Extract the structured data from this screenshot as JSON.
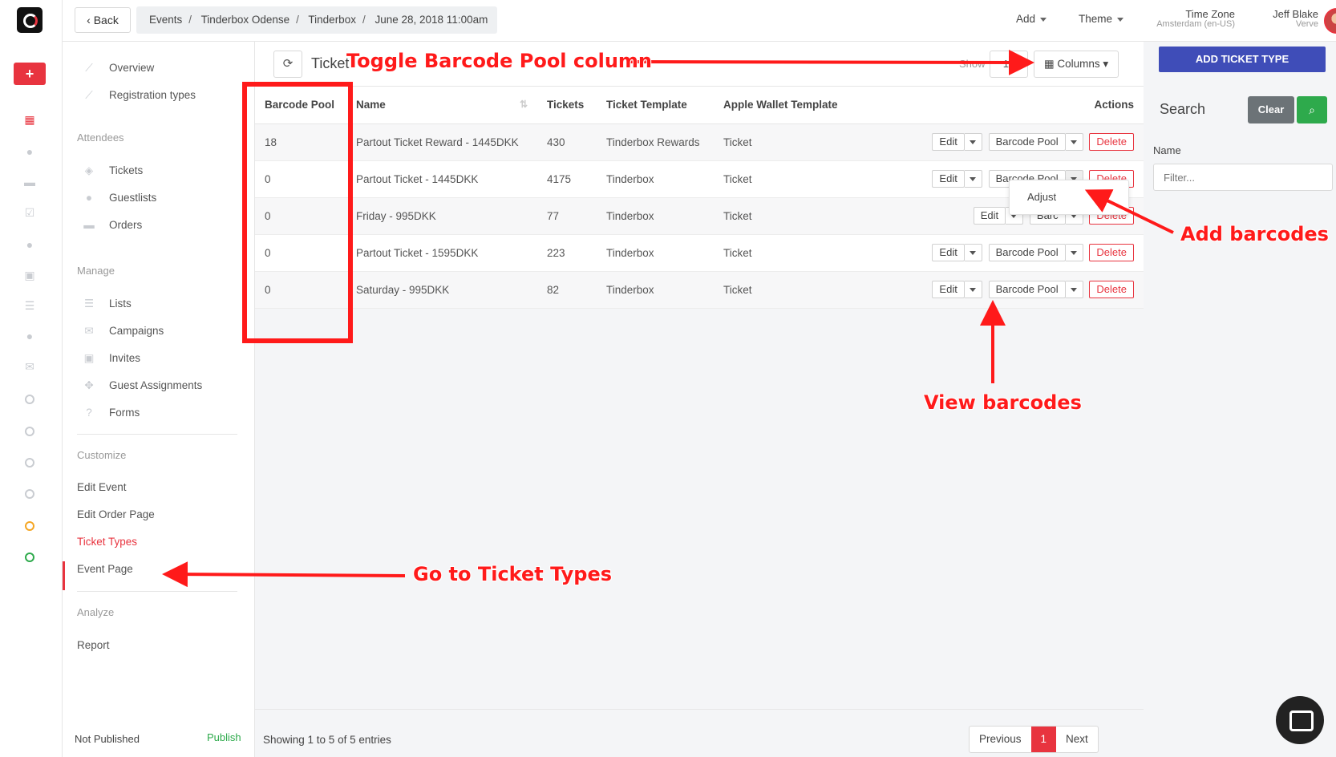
{
  "topbar": {
    "back_label": "Back",
    "breadcrumbs": [
      "Events",
      "Tinderbox Odense",
      "Tinderbox",
      "June 28, 2018 11:00am"
    ],
    "add_menu": "Add",
    "theme_menu": "Theme",
    "timezone_label": "Time Zone",
    "timezone_value": "Amsterdam (en-US)",
    "user_name": "Jeff Blake",
    "user_org": "Verve"
  },
  "sidebar": {
    "overview": "Overview",
    "registration_types": "Registration types",
    "attendees_header": "Attendees",
    "tickets": "Tickets",
    "guestlists": "Guestlists",
    "orders": "Orders",
    "manage_header": "Manage",
    "lists": "Lists",
    "campaigns": "Campaigns",
    "invites": "Invites",
    "guest_assignments": "Guest Assignments",
    "forms": "Forms",
    "customize_header": "Customize",
    "edit_event": "Edit Event",
    "edit_order_page": "Edit Order Page",
    "ticket_types": "Ticket Types",
    "event_page": "Event Page",
    "analyze_header": "Analyze",
    "report": "Report",
    "status": "Not Published",
    "publish": "Publish"
  },
  "main": {
    "title": "Ticket",
    "show_label": "Show",
    "show_value": "10",
    "columns_label": "Columns",
    "table": {
      "headers": [
        "Barcode Pool",
        "Name",
        "Tickets",
        "Ticket Template",
        "Apple Wallet Template",
        "Actions"
      ],
      "rows": [
        {
          "pool": "18",
          "name": "Partout Ticket Reward - 1445DKK",
          "tickets": "430",
          "template": "Tinderbox Rewards",
          "wallet": "Ticket"
        },
        {
          "pool": "0",
          "name": "Partout Ticket - 1445DKK",
          "tickets": "4175",
          "template": "Tinderbox",
          "wallet": "Ticket"
        },
        {
          "pool": "0",
          "name": "Friday - 995DKK",
          "tickets": "77",
          "template": "Tinderbox",
          "wallet": "Ticket"
        },
        {
          "pool": "0",
          "name": "Partout Ticket - 1595DKK",
          "tickets": "223",
          "template": "Tinderbox",
          "wallet": "Ticket"
        },
        {
          "pool": "0",
          "name": "Saturday - 995DKK",
          "tickets": "82",
          "template": "Tinderbox",
          "wallet": "Ticket"
        }
      ],
      "edit_label": "Edit",
      "barcode_label": "Barcode Pool",
      "barcode_truncated": "Barc",
      "delete_label": "Delete"
    },
    "dropdown_item": "Adjust",
    "footer_info": "Showing 1 to 5 of 5 entries",
    "pager": {
      "prev": "Previous",
      "current": "1",
      "next": "Next"
    }
  },
  "right": {
    "add_ticket_type": "ADD TICKET TYPE",
    "search_title": "Search",
    "clear_label": "Clear",
    "name_label": "Name",
    "filter_placeholder": "Filter..."
  },
  "annotations": {
    "toggle": "Toggle Barcode Pool column",
    "add_barcodes": "Add barcodes",
    "view_barcodes": "View barcodes",
    "go_ticket_types": "Go to Ticket Types",
    "color": "#ff1a1a"
  },
  "icons": {
    "logo": "app-logo",
    "refresh": "refresh-icon",
    "search": "search-icon",
    "chat": "chat-icon"
  }
}
